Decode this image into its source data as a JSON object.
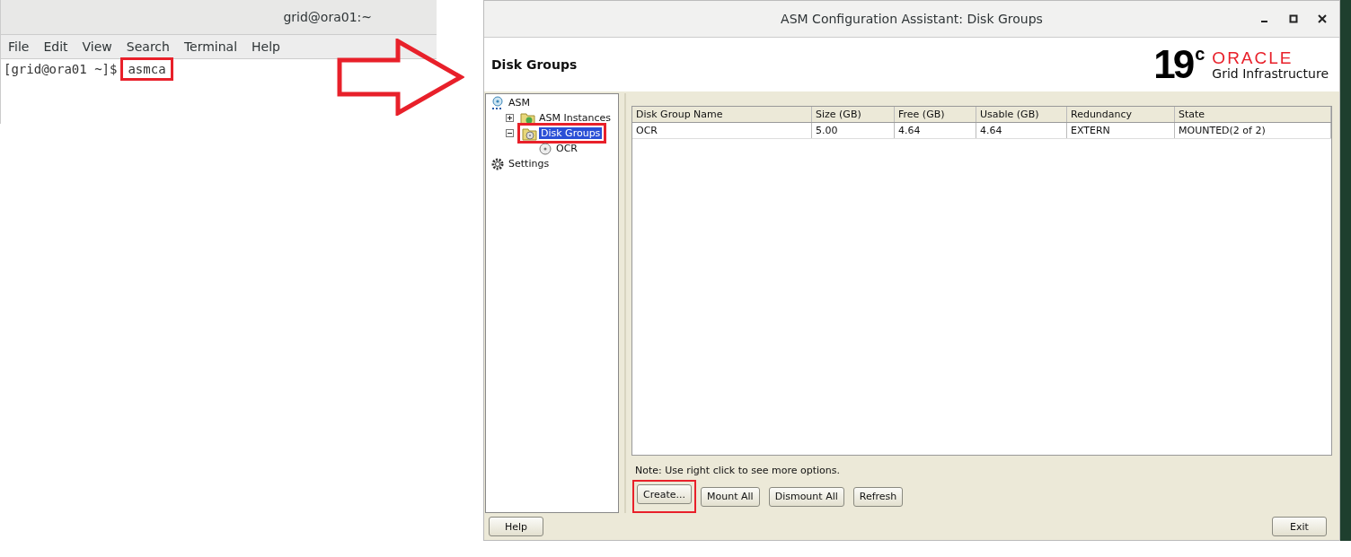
{
  "terminal": {
    "title": "grid@ora01:~",
    "menu": [
      "File",
      "Edit",
      "View",
      "Search",
      "Terminal",
      "Help"
    ],
    "lines": [
      {
        "prompt": "[grid@ora01 ~]$",
        "command": "asmca",
        "highlighted": true
      }
    ]
  },
  "asmca": {
    "title": "ASM Configuration Assistant: Disk Groups",
    "heading": "Disk Groups",
    "logo": {
      "version": "19",
      "suffix": "c",
      "brand": "ORACLE",
      "product": "Grid Infrastructure"
    },
    "tree": [
      {
        "label": "ASM",
        "kind": "asm",
        "selected": false,
        "highlighted": false,
        "children": [
          {
            "label": "ASM Instances",
            "kind": "instances",
            "selected": false,
            "highlighted": false,
            "expanded": false
          },
          {
            "label": "Disk Groups",
            "kind": "diskgroups",
            "selected": true,
            "highlighted": true,
            "expanded": true,
            "children": [
              {
                "label": "OCR",
                "kind": "disk",
                "selected": false,
                "highlighted": false
              }
            ]
          }
        ]
      },
      {
        "label": "Settings",
        "kind": "settings",
        "selected": false,
        "highlighted": false
      }
    ],
    "table": {
      "columns": [
        "Disk Group Name",
        "Size (GB)",
        "Free (GB)",
        "Usable (GB)",
        "Redundancy",
        "State"
      ],
      "rows": [
        [
          "OCR",
          "5.00",
          "4.64",
          "4.64",
          "EXTERN",
          "MOUNTED(2 of 2)"
        ]
      ]
    },
    "note": "Note: Use right click to see more options.",
    "actions": [
      {
        "label": "Create...",
        "highlighted": true
      },
      {
        "label": "Mount All",
        "highlighted": false
      },
      {
        "label": "Dismount All",
        "highlighted": false
      },
      {
        "label": "Refresh",
        "highlighted": false
      }
    ],
    "footer": {
      "help": "Help",
      "exit": "Exit"
    }
  }
}
